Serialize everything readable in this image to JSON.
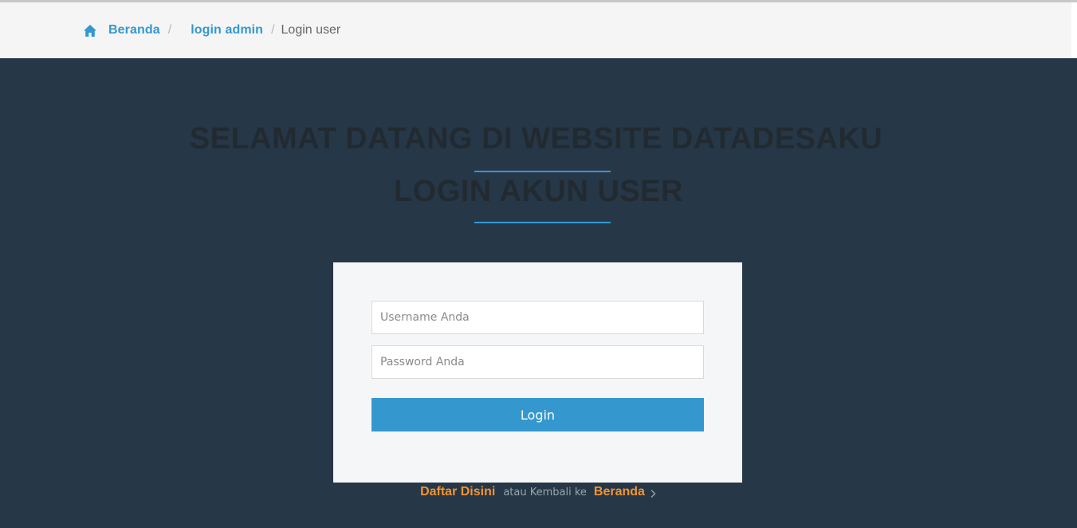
{
  "breadcrumb": {
    "home_label": "Beranda",
    "separator": "/",
    "admin_label": "login admin",
    "current_label": "Login user"
  },
  "hero": {
    "title": "SELAMAT DATANG DI WEBSITE DATADESAKU",
    "subtitle": "LOGIN AKUN USER"
  },
  "form": {
    "username_placeholder": "Username Anda",
    "password_placeholder": "Password Anda",
    "submit_label": "Login"
  },
  "footer": {
    "register_label": "Daftar Disini",
    "middle_text": "atau Kembali ke",
    "home_label": "Beranda"
  },
  "colors": {
    "background": "#263747",
    "accent": "#3498cf",
    "link_orange": "#f29432",
    "card": "#f5f6f8"
  },
  "icons": [
    "home-icon",
    "chevron-right-icon"
  ]
}
